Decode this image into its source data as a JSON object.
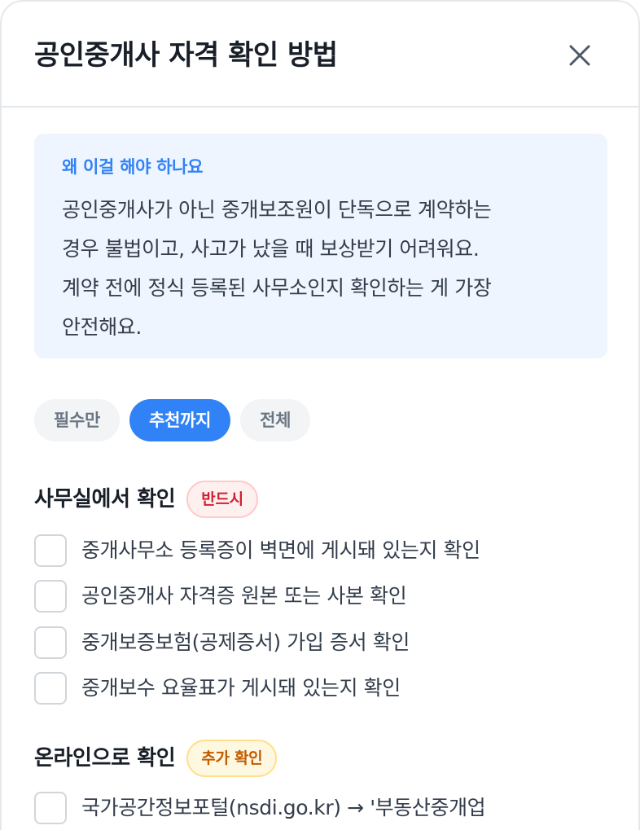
{
  "header": {
    "title": "공인중개사 자격 확인 방법",
    "close_icon": "close-icon"
  },
  "info": {
    "heading": "왜 이걸 해야 하나요",
    "lines": [
      "공인중개사가 아닌 중개보조원이 단독으로 계약하는",
      "경우 불법이고, 사고가 났을 때 보상받기 어려워요.",
      "계약 전에 정식 등록된 사무소인지 확인하는 게 가장",
      "안전해요."
    ]
  },
  "filters": [
    {
      "label": "필수만",
      "selected": false
    },
    {
      "label": "추천까지",
      "selected": true
    },
    {
      "label": "전체",
      "selected": false
    }
  ],
  "sections": [
    {
      "title": "사무실에서 확인",
      "badge": "반드시",
      "badge_color": "#d22030",
      "items": [
        "중개사무소 등록증이 벽면에 게시돼 있는지 확인",
        "공인중개사 자격증 원본 또는 사본 확인",
        "중개보증보험(공제증서) 가입 증서 확인",
        "중개보수 요율표가 게시돼 있는지 확인"
      ]
    },
    {
      "title": "온라인으로 확인",
      "badge": "추가 확인",
      "badge_color": "#c25b00",
      "items": [
        "국가공간정보포털(nsdi.go.kr) → '부동산중개업"
      ]
    }
  ],
  "colors": {
    "accent": "#3182f6",
    "info_bg": "#eef5fe"
  }
}
